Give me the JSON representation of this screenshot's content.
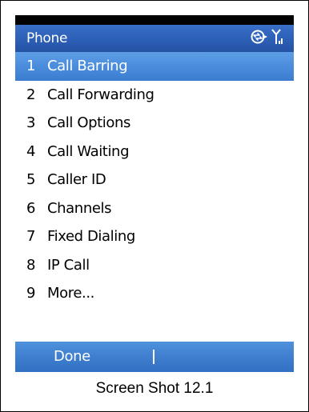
{
  "title_bar": {
    "title": "Phone",
    "icons": [
      "data-connection-icon",
      "signal-strength-icon"
    ],
    "background_color": "#2c5fb6"
  },
  "menu": {
    "selected_index": 0,
    "selected_color": "#4b8ddc",
    "items": [
      {
        "number": "1",
        "label": "Call Barring"
      },
      {
        "number": "2",
        "label": "Call Forwarding"
      },
      {
        "number": "3",
        "label": "Call Options"
      },
      {
        "number": "4",
        "label": "Call Waiting"
      },
      {
        "number": "5",
        "label": "Caller ID"
      },
      {
        "number": "6",
        "label": "Channels"
      },
      {
        "number": "7",
        "label": "Fixed Dialing"
      },
      {
        "number": "8",
        "label": "IP Call"
      },
      {
        "number": "9",
        "label": "More..."
      }
    ]
  },
  "softkeys": {
    "left_label": "Done"
  },
  "caption": "Screen Shot 12.1"
}
